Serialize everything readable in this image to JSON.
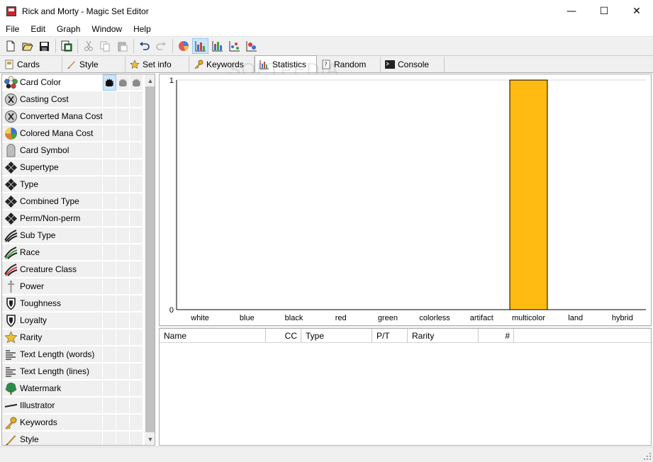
{
  "window": {
    "title": "Rick and Morty - Magic Set Editor",
    "controls": [
      "—",
      "☐",
      "✕"
    ]
  },
  "menu": [
    "File",
    "Edit",
    "Graph",
    "Window",
    "Help"
  ],
  "toolbar": {
    "buttons": [
      "new-icon",
      "open-icon",
      "save-icon",
      "export-icon",
      "cut-icon",
      "copy-icon",
      "paste-icon",
      "undo-icon",
      "redo-icon",
      "pie-graph-icon",
      "bar-graph-icon",
      "stacked-bar-icon",
      "scatter-icon",
      "scatter-pie-icon"
    ],
    "active": "bar-graph-icon"
  },
  "tabs": [
    {
      "label": "Cards",
      "icon": "cards-icon"
    },
    {
      "label": "Style",
      "icon": "brush-icon"
    },
    {
      "label": "Set info",
      "icon": "star-icon"
    },
    {
      "label": "Keywords",
      "icon": "key-icon"
    },
    {
      "label": "Statistics",
      "icon": "chart-icon",
      "active": true
    },
    {
      "label": "Random",
      "icon": "random-icon"
    },
    {
      "label": "Console",
      "icon": "console-icon"
    }
  ],
  "watermark": "SOFTPEDIA",
  "statistics": {
    "dimensions": [
      {
        "label": "Card Color",
        "icon": "card-color-icon"
      },
      {
        "label": "Casting Cost",
        "icon": "mana-x-icon"
      },
      {
        "label": "Converted Mana Cost",
        "icon": "mana-x-icon"
      },
      {
        "label": "Colored Mana Cost",
        "icon": "colored-mana-icon"
      },
      {
        "label": "Card Symbol",
        "icon": "tombstone-icon"
      },
      {
        "label": "Supertype",
        "icon": "type-icon"
      },
      {
        "label": "Type",
        "icon": "type-icon"
      },
      {
        "label": "Combined Type",
        "icon": "type-icon"
      },
      {
        "label": "Perm/Non-perm",
        "icon": "type-icon"
      },
      {
        "label": "Sub Type",
        "icon": "claw-icon"
      },
      {
        "label": "Race",
        "icon": "claw-green-icon"
      },
      {
        "label": "Creature Class",
        "icon": "claw-red-icon"
      },
      {
        "label": "Power",
        "icon": "sword-icon"
      },
      {
        "label": "Toughness",
        "icon": "shield-icon"
      },
      {
        "label": "Loyalty",
        "icon": "shield-icon"
      },
      {
        "label": "Rarity",
        "icon": "rarity-star-icon"
      },
      {
        "label": "Text Length (words)",
        "icon": "text-lines-icon"
      },
      {
        "label": "Text Length (lines)",
        "icon": "text-lines-icon"
      },
      {
        "label": "Watermark",
        "icon": "tree-icon"
      },
      {
        "label": "Illustrator",
        "icon": "pen-icon"
      },
      {
        "label": "Keywords",
        "icon": "key-icon"
      },
      {
        "label": "Style",
        "icon": "brush-icon"
      }
    ],
    "selected_row": 0,
    "selected_dimension_columns": 1
  },
  "chart_data": {
    "type": "bar",
    "categories": [
      "white",
      "blue",
      "black",
      "red",
      "green",
      "colorless",
      "artifact",
      "multicolor",
      "land",
      "hybrid"
    ],
    "values": [
      0,
      0,
      0,
      0,
      0,
      0,
      0,
      1,
      0,
      0
    ],
    "ylim": [
      0,
      1
    ],
    "y_ticks": [
      "0",
      "1"
    ],
    "bar_color": "#ffbb11",
    "grid": "top line only"
  },
  "card_list": {
    "columns": [
      "Name",
      "CC",
      "Type",
      "P/T",
      "Rarity",
      "#"
    ],
    "rows": []
  }
}
